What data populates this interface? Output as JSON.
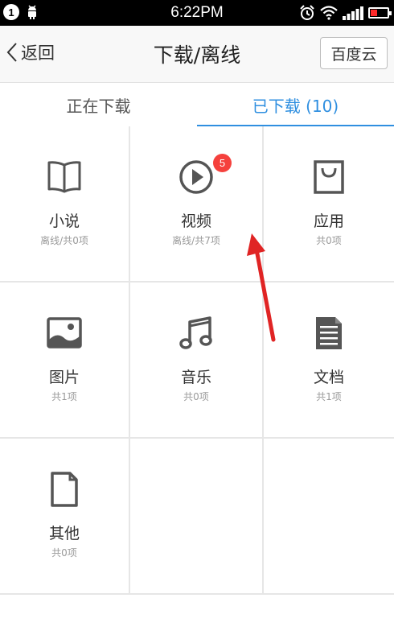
{
  "status_bar": {
    "notification_count": "1",
    "time": "6:22PM",
    "battery_color": "#ff2a2a",
    "battery_level": 0.4
  },
  "header": {
    "back_label": "返回",
    "title": "下载/离线",
    "cloud_button": "百度云"
  },
  "tabs": [
    {
      "label": "正在下载",
      "active": false
    },
    {
      "label": "已下载 (10)",
      "active": true
    }
  ],
  "categories": [
    {
      "name": "小说",
      "sub": "离线/共0项",
      "icon": "book-icon"
    },
    {
      "name": "视频",
      "sub": "离线/共7项",
      "icon": "play-icon",
      "badge": "5"
    },
    {
      "name": "应用",
      "sub": "共0项",
      "icon": "shopping-bag-icon"
    },
    {
      "name": "图片",
      "sub": "共1项",
      "icon": "image-icon"
    },
    {
      "name": "音乐",
      "sub": "共0项",
      "icon": "music-note-icon"
    },
    {
      "name": "文档",
      "sub": "共1项",
      "icon": "document-icon"
    },
    {
      "name": "其他",
      "sub": "共0项",
      "icon": "file-icon"
    }
  ],
  "colors": {
    "accent": "#2f8fe0",
    "badge": "#f5413d",
    "annotation_arrow": "#e02424",
    "icon": "#555555"
  }
}
